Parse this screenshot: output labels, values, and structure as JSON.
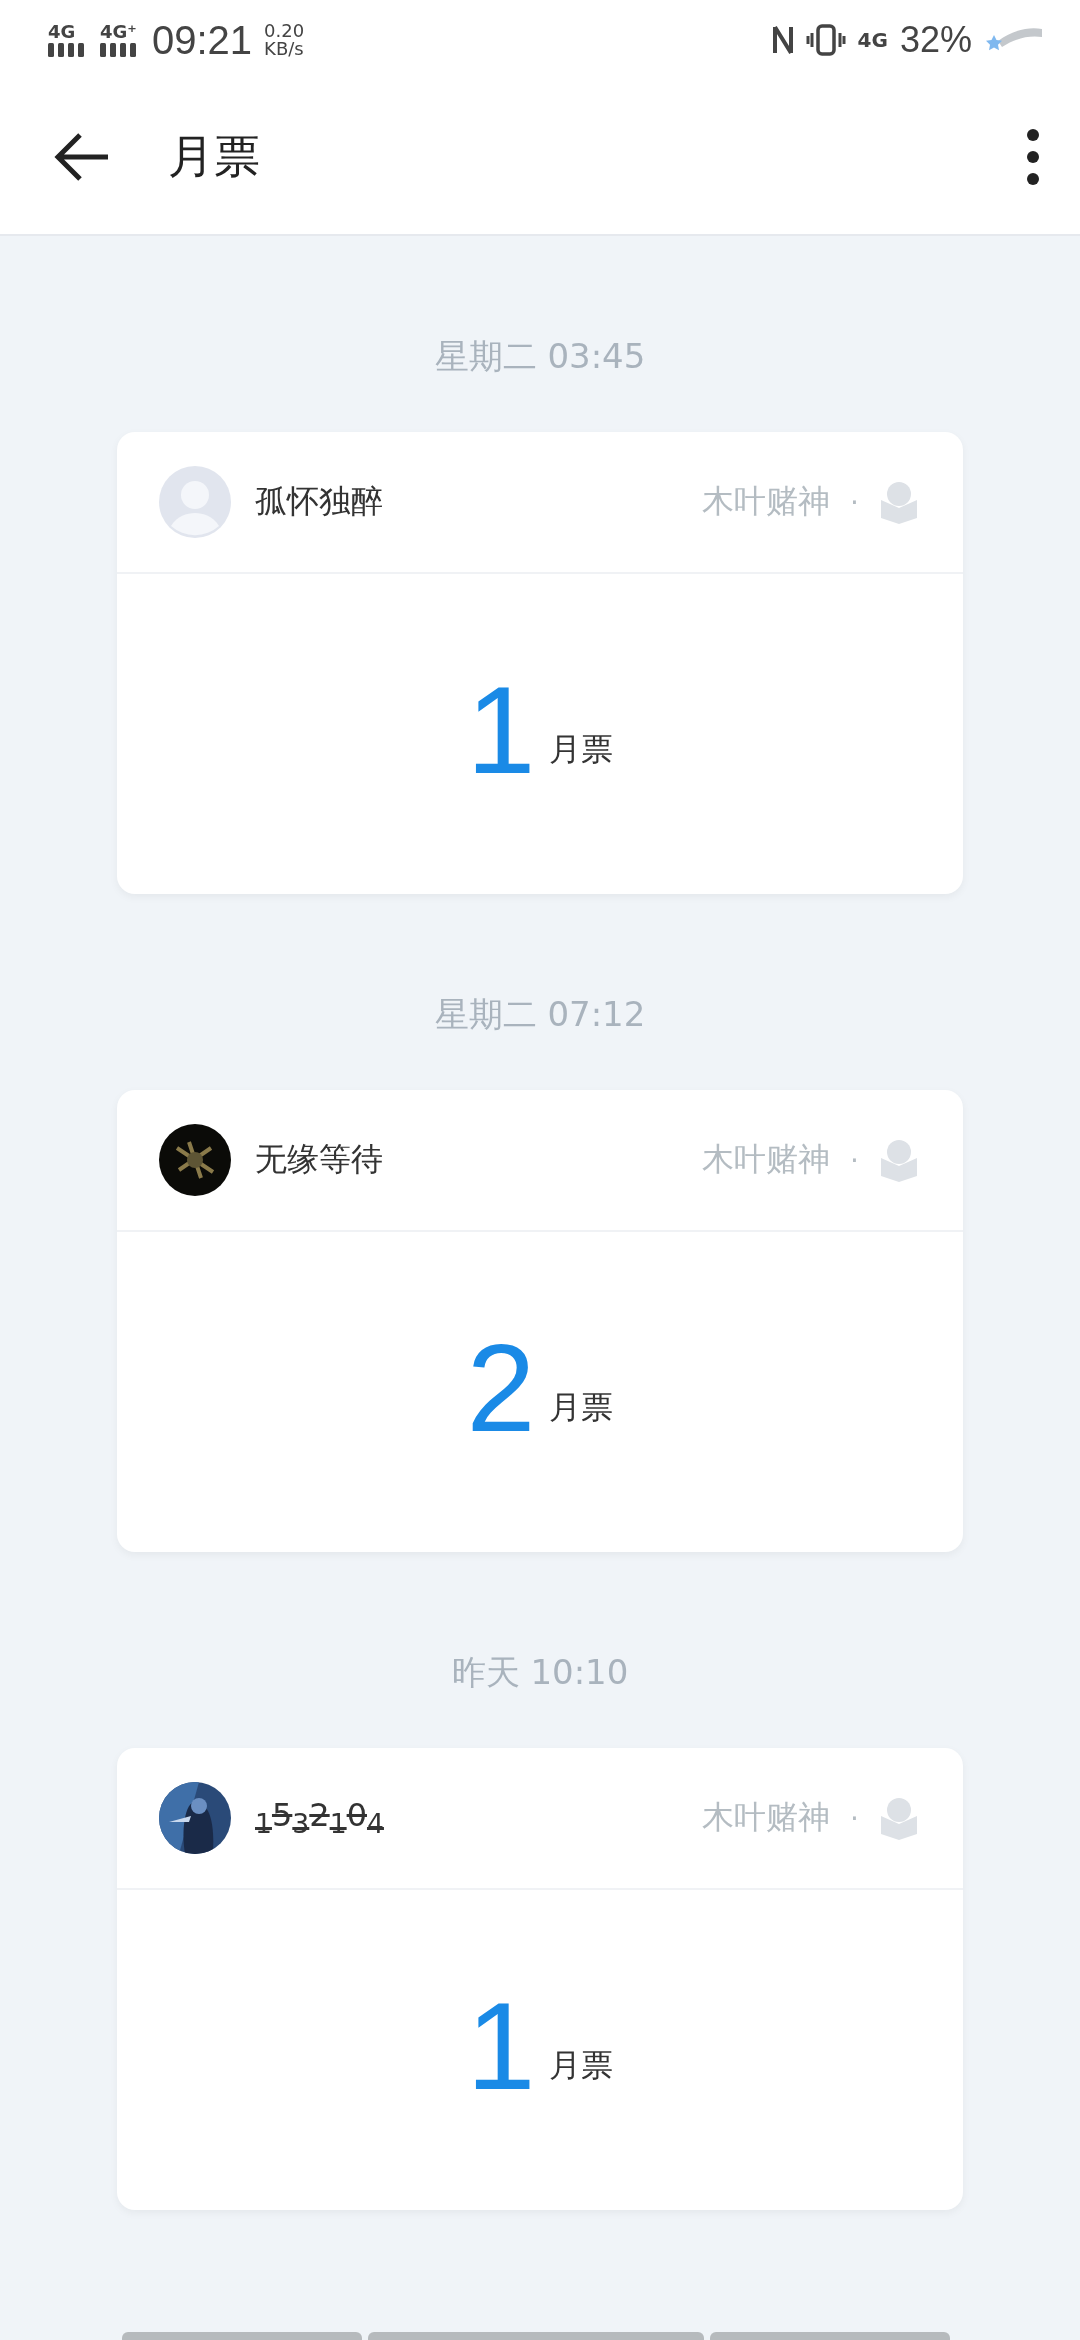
{
  "status_bar": {
    "network_1": "4G",
    "network_2": "4G⁺",
    "time": "09:21",
    "speed_value": "0.20",
    "speed_unit": "KB/s",
    "network_3": "4G",
    "battery": "32%"
  },
  "toolbar": {
    "title": "月票"
  },
  "records": [
    {
      "time": "星期二 03:45",
      "user": "孤怀独醉",
      "avatar": {
        "kind": "placeholder"
      },
      "strikethrough": false,
      "author": "木叶赌神",
      "separator": "·",
      "amount": "1",
      "unit": "月票"
    },
    {
      "time": "星期二 07:12",
      "user": "无缘等待",
      "strikethrough": false,
      "author": "木叶赌神",
      "separator": "·",
      "amount": "2",
      "unit": "月票"
    },
    {
      "time": "昨天 10:10",
      "user": "$_{1}$5$_{3}$2$_{1}$0$_{4}$",
      "strikethrough": true,
      "author": "木叶赌神",
      "separator": "·",
      "amount": "1",
      "unit": "月票"
    }
  ]
}
